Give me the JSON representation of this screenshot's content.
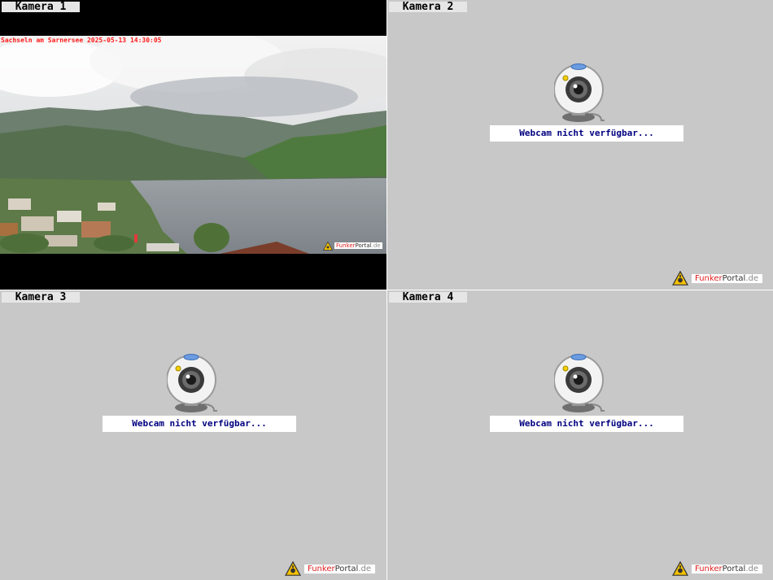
{
  "cameras": [
    {
      "label": "Kamera 1",
      "status": "live",
      "overlay": "Sachseln am Sarnersee 2025-05-13 14:30:05"
    },
    {
      "label": "Kamera 2",
      "status": "unavailable",
      "message": "Webcam nicht verfügbar..."
    },
    {
      "label": "Kamera 3",
      "status": "unavailable",
      "message": "Webcam nicht verfügbar..."
    },
    {
      "label": "Kamera 4",
      "status": "unavailable",
      "message": "Webcam nicht verfügbar..."
    }
  ],
  "brand": {
    "part1": "Funker",
    "part2": "Portal",
    "part3": ".de"
  },
  "colors": {
    "brand_red": "#e02020",
    "message_blue": "#000080",
    "overlay_red": "#ff1a1a"
  }
}
